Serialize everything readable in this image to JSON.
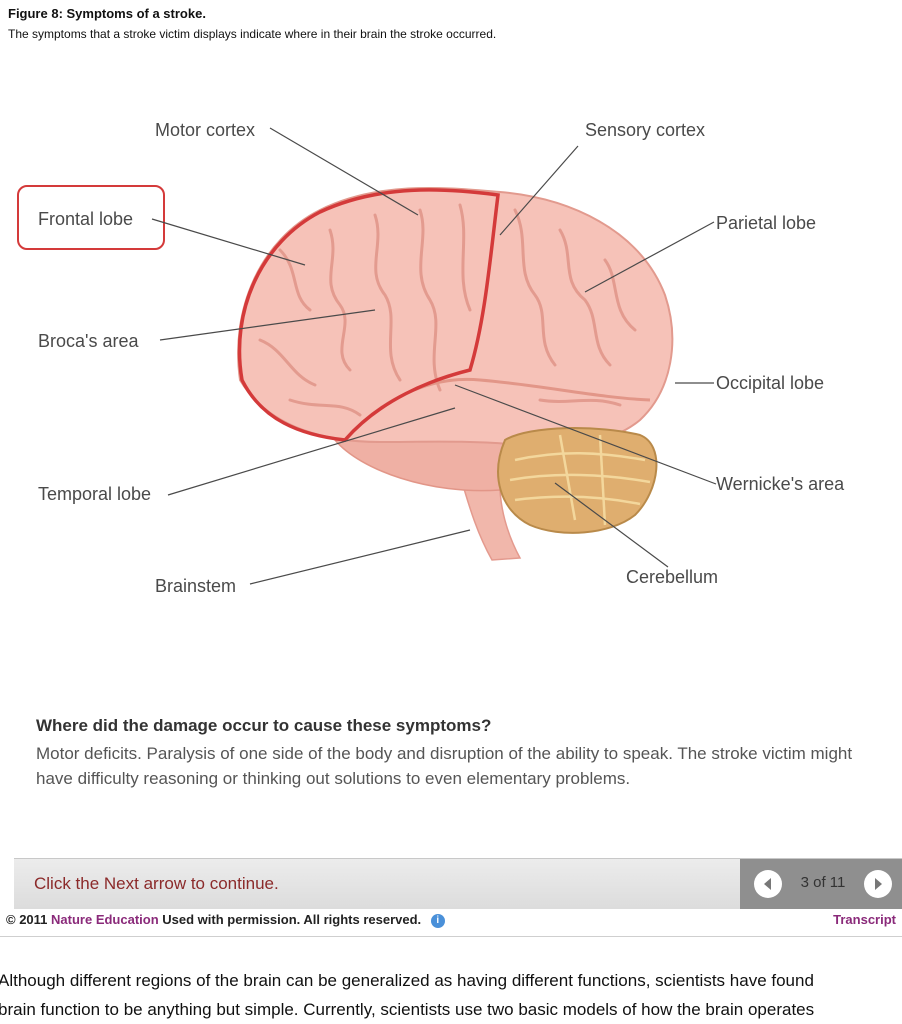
{
  "figure": {
    "title": "Figure 8: Symptoms of a stroke.",
    "caption": "The symptoms that a stroke victim displays indicate where in their brain the stroke occurred."
  },
  "diagram": {
    "labels": {
      "motor_cortex": "Motor cortex",
      "sensory_cortex": "Sensory cortex",
      "frontal_lobe": "Frontal lobe",
      "parietal_lobe": "Parietal lobe",
      "brocas_area": "Broca's area",
      "occipital_lobe": "Occipital lobe",
      "temporal_lobe": "Temporal lobe",
      "wernickes_area": "Wernicke's area",
      "brainstem": "Brainstem",
      "cerebellum": "Cerebellum"
    },
    "highlighted": "Frontal lobe",
    "colors": {
      "highlight": "#d43a3a",
      "brain": "#f4b9ae",
      "cerebellum": "#d9a86a",
      "line": "#4a4a4a"
    }
  },
  "question": {
    "heading": "Where did the damage occur to cause these symptoms?",
    "text": "Motor deficits. Paralysis of one side of the body and disruption of the ability to speak. The stroke victim might have difficulty reasoning or thinking out solutions to even elementary problems."
  },
  "nav": {
    "prompt": "Click the Next arrow to continue.",
    "page": "3 of 11",
    "prev_icon": "chevron-left-icon",
    "next_icon": "chevron-right-icon"
  },
  "footer": {
    "copyright": "© 2011",
    "organization": "Nature Education",
    "rights": "Used with permission. All rights reserved.",
    "info_icon": "info-icon",
    "transcript": "Transcript"
  },
  "article": {
    "line1": "Although different regions of the brain can be generalized as having different functions, scientists have found",
    "line2": "brain function to be anything but simple. Currently, scientists use two basic models of how the brain operates"
  }
}
